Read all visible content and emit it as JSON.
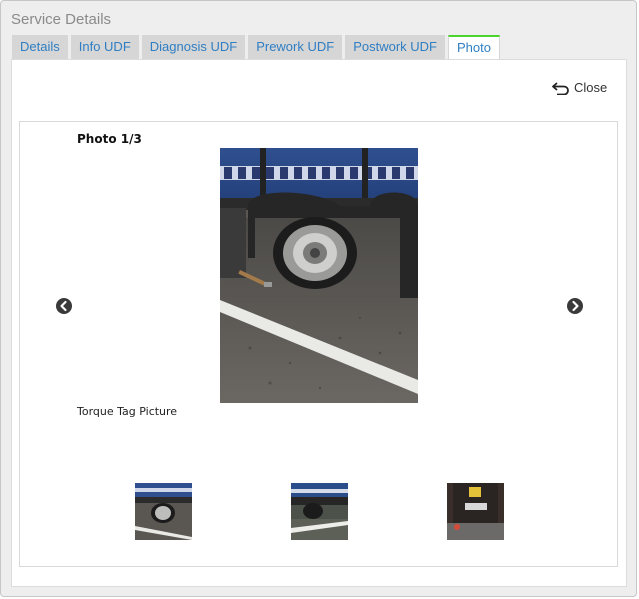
{
  "window": {
    "title": "Service Details"
  },
  "tabs": [
    {
      "label": "Details",
      "active": false
    },
    {
      "label": "Info UDF",
      "active": false
    },
    {
      "label": "Diagnosis UDF",
      "active": false
    },
    {
      "label": "Prework UDF",
      "active": false
    },
    {
      "label": "Postwork UDF",
      "active": false
    },
    {
      "label": "Photo",
      "active": true
    }
  ],
  "toolbar": {
    "close_label": "Close",
    "close_icon": "undo-arrow-icon"
  },
  "photo_viewer": {
    "counter": "Photo 1/3",
    "caption": "Torque Tag Picture",
    "prev_icon": "chevron-left-circle-icon",
    "next_icon": "chevron-right-circle-icon",
    "main_photo_subject": "truck wheel removed near trailer",
    "thumbnails": [
      {
        "subject": "truck wheel near trailer"
      },
      {
        "subject": "trailer wheel on road markings"
      },
      {
        "subject": "rear of trailer with plate"
      }
    ]
  },
  "colors": {
    "tab_text": "#2f7ec3",
    "active_tab_accent": "#4bd32e",
    "tab_background": "#d6d6d6"
  }
}
